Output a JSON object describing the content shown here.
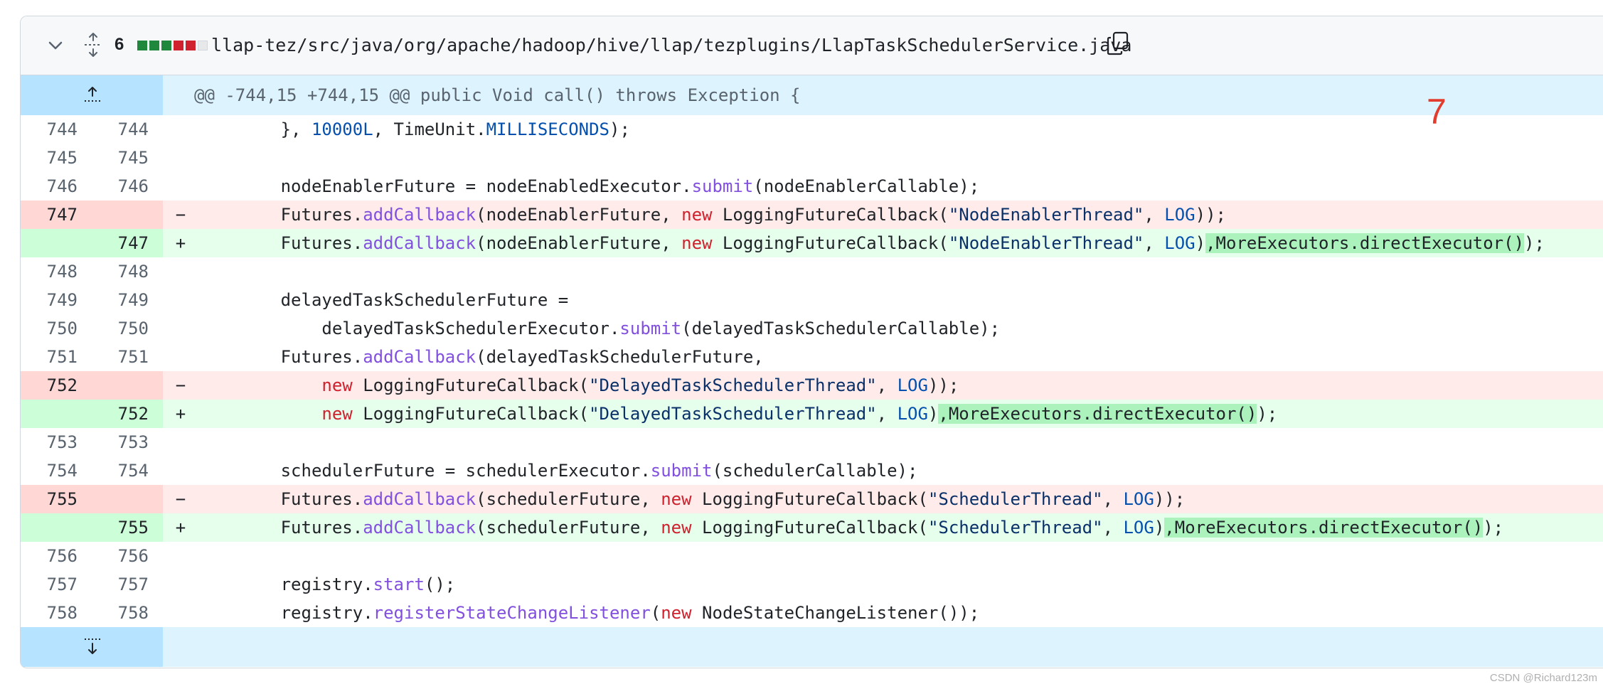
{
  "file": {
    "changes": "6",
    "path": "llap-tez/src/java/org/apache/hadoop/hive/llap/tezplugins/LlapTaskSchedulerService.java"
  },
  "hunk": {
    "header": "@@ -744,15 +744,15 @@ public Void call() throws Exception {"
  },
  "lines": [
    {
      "old": "744",
      "new": "744",
      "sign": ""
    },
    {
      "old": "745",
      "new": "745",
      "sign": ""
    },
    {
      "old": "746",
      "new": "746",
      "sign": ""
    },
    {
      "old": "747",
      "new": "",
      "sign": "−"
    },
    {
      "old": "",
      "new": "747",
      "sign": "+"
    },
    {
      "old": "748",
      "new": "748",
      "sign": ""
    },
    {
      "old": "749",
      "new": "749",
      "sign": ""
    },
    {
      "old": "750",
      "new": "750",
      "sign": ""
    },
    {
      "old": "751",
      "new": "751",
      "sign": ""
    },
    {
      "old": "752",
      "new": "",
      "sign": "−"
    },
    {
      "old": "",
      "new": "752",
      "sign": "+"
    },
    {
      "old": "753",
      "new": "753",
      "sign": ""
    },
    {
      "old": "754",
      "new": "754",
      "sign": ""
    },
    {
      "old": "755",
      "new": "",
      "sign": "−"
    },
    {
      "old": "",
      "new": "755",
      "sign": "+"
    },
    {
      "old": "756",
      "new": "756",
      "sign": ""
    },
    {
      "old": "757",
      "new": "757",
      "sign": ""
    },
    {
      "old": "758",
      "new": "758",
      "sign": ""
    }
  ],
  "code": {
    "l744a": "        }, ",
    "l744b": "10000L",
    "l744c": ", TimeUnit.",
    "l744d": "MILLISECONDS",
    "l744e": ");",
    "l746a": "        nodeEnablerFuture = nodeEnabledExecutor.",
    "submit": "submit",
    "l746b": "(nodeEnablerCallable);",
    "futures": "        Futures.",
    "addCallback": "addCallback",
    "l747a": "(nodeEnablerFuture, ",
    "new": "new",
    "lfc": " LoggingFutureCallback(",
    "s_node": "\"NodeEnablerThread\"",
    "comma": ", ",
    "LOG": "LOG",
    "end_old": "));",
    "close": ")",
    "me": ",MoreExecutors.directExecutor()",
    "end_new": ");",
    "l749": "        delayedTaskSchedulerFuture =",
    "l750a": "            delayedTaskSchedulerExecutor.",
    "l750b": "(delayedTaskSchedulerCallable);",
    "l751b": "(delayedTaskSchedulerFuture,",
    "indent12": "            ",
    "s_delayed": "\"DelayedTaskSchedulerThread\"",
    "l754a": "        schedulerFuture = schedulerExecutor.",
    "l754b": "(schedulerCallable);",
    "l755a": "(schedulerFuture, ",
    "s_sched": "\"SchedulerThread\"",
    "l757a": "        registry.",
    "start": "start",
    "l757b": "();",
    "l758a": "        registry.",
    "rscl": "registerStateChangeListener",
    "l758b": "(",
    "l758c": " NodeStateChangeListener());"
  },
  "annotation": "7",
  "watermark": "CSDN @Richard123m",
  "colors": {
    "addition": "#1f883d",
    "deletion": "#cf222e",
    "hunk": "#ddf4ff",
    "marker": "#e33b2e"
  },
  "icons": [
    "chevron-down-icon",
    "unfold-icon",
    "copy-icon",
    "expand-up-icon",
    "expand-down-icon"
  ]
}
